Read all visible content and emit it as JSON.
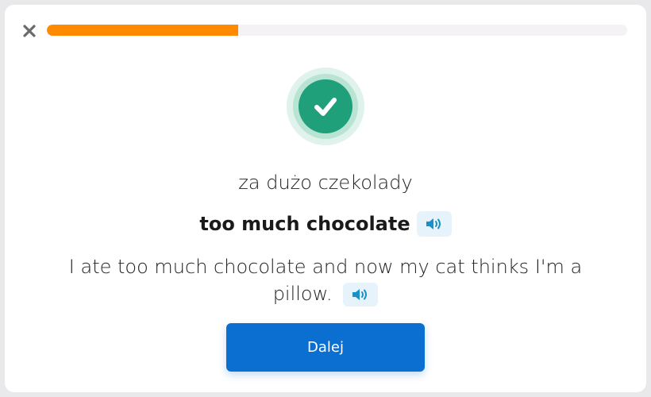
{
  "progress": {
    "fraction": 0.33,
    "color": "#ff8a00"
  },
  "icons": {
    "close": "close-icon",
    "result": "checkmark-icon",
    "audio": "speaker-icon"
  },
  "card": {
    "source_phrase": "za dużo czekolady",
    "target_phrase": "too much chocolate",
    "example_sentence": "I ate too much chocolate and now my cat thinks I'm a pillow."
  },
  "actions": {
    "continue_label": "Dalej"
  },
  "colors": {
    "accent": "#0a6fd0",
    "success": "#1fa07a",
    "audio_icon": "#1a90c8"
  }
}
